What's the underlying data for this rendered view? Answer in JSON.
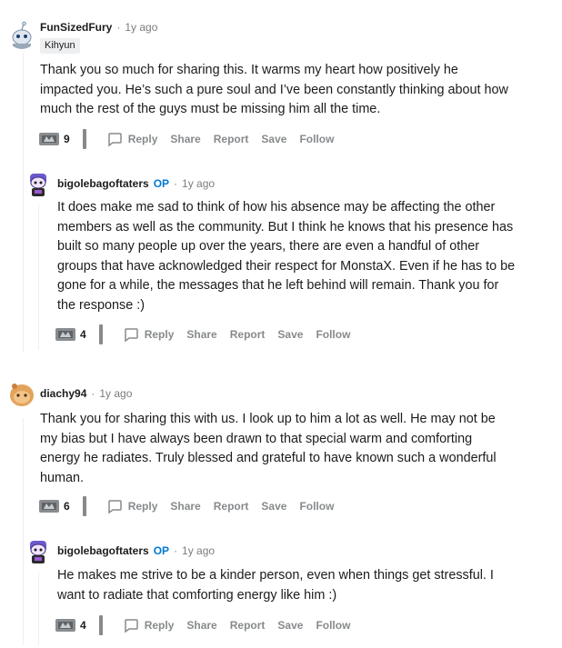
{
  "comments": [
    {
      "username": "FunSizedFury",
      "time": "1y ago",
      "flair": "Kihyun",
      "op": "",
      "lines": [
        "Thank you so much for sharing this. It warms my heart how positively he",
        "impacted you. He’s such a pure soul and I’ve been constantly thinking about how",
        "much the rest of the guys must be missing him all the time."
      ],
      "votes": "9"
    },
    {
      "username": "bigolebagoftaters",
      "time": "1y ago",
      "op": "OP",
      "lines": [
        "It does make me sad to think of how his absence may be affecting the other",
        "members as well as the community. But I think he knows that his presence has",
        "built so many people up over the years, there are even a handful of other",
        "groups that have acknowledged their respect for MonstaX. Even if he has to be",
        "gone for a while, the messages that he left behind will remain. Thank you for",
        "the response :)"
      ],
      "votes": "4"
    },
    {
      "username": "diachy94",
      "time": "1y ago",
      "op": "",
      "lines": [
        "Thank you for sharing this with us. I look up to him a lot as well. He may not be",
        "my bias but I have always been drawn to that special warm and comforting",
        "energy he radiates. Truly blessed and grateful to have known such a wonderful",
        "human."
      ],
      "votes": "6"
    },
    {
      "username": "bigolebagoftaters",
      "time": "1y ago",
      "op": "OP",
      "lines": [
        "He makes me strive to be a kinder person, even when things get stressful. I",
        "want to radiate that comforting energy like him :)"
      ],
      "votes": "4"
    }
  ],
  "actions": {
    "reply": "Reply",
    "share": "Share",
    "report": "Report",
    "save": "Save",
    "follow": "Follow"
  },
  "separator": "·",
  "icons": {
    "award": "award-icon",
    "reply": "reply-bubble-icon",
    "avatar": "snoo-avatar"
  }
}
